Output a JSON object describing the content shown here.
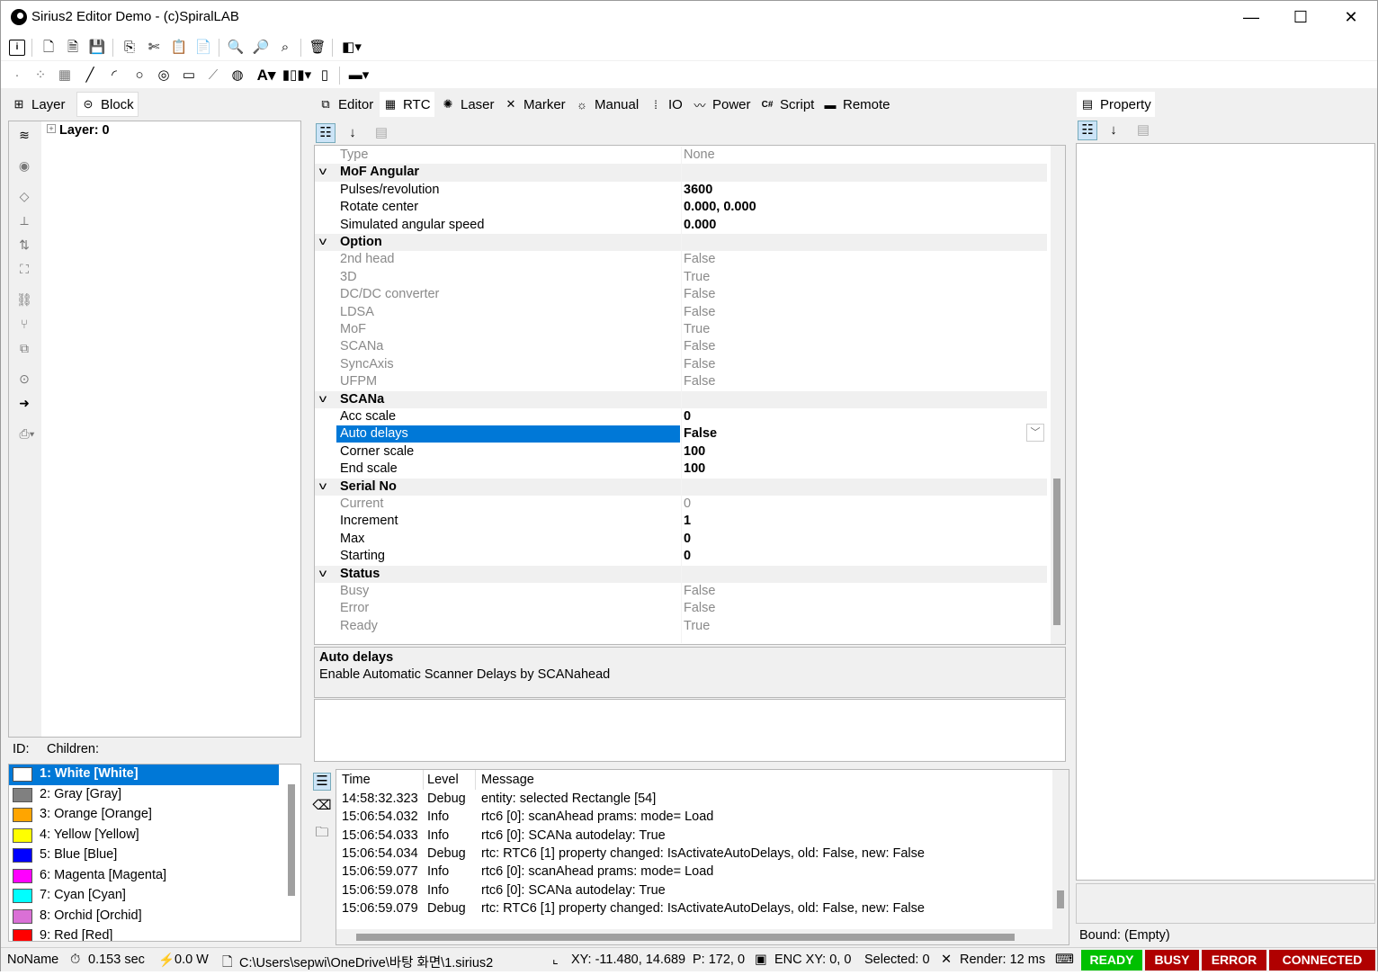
{
  "window": {
    "title": "Sirius2 Editor Demo - (c)SpiralLAB",
    "minimize": "—",
    "maximize": "☐",
    "close": "✕"
  },
  "left_tabs": {
    "layer": "Layer",
    "block": "Block"
  },
  "tree": {
    "root": "Layer: 0"
  },
  "id_bar": {
    "id": "ID:",
    "children": "Children:"
  },
  "layers": [
    {
      "label": "1: White [White]",
      "color": "#ffffff"
    },
    {
      "label": "2: Gray [Gray]",
      "color": "#808080"
    },
    {
      "label": "3: Orange [Orange]",
      "color": "#ffa500"
    },
    {
      "label": "4: Yellow [Yellow]",
      "color": "#ffff00"
    },
    {
      "label": "5: Blue [Blue]",
      "color": "#0000ff"
    },
    {
      "label": "6: Magenta [Magenta]",
      "color": "#ff00ff"
    },
    {
      "label": "7: Cyan [Cyan]",
      "color": "#00ffff"
    },
    {
      "label": "8: Orchid [Orchid]",
      "color": "#da70d6"
    },
    {
      "label": "9: Red [Red]",
      "color": "#ff0000"
    }
  ],
  "center_tabs": [
    "Editor",
    "RTC",
    "Laser",
    "Marker",
    "Manual",
    "IO",
    "Power",
    "Script",
    "Remote"
  ],
  "grid": {
    "rows": [
      {
        "n": "Type",
        "v": "None",
        "t": "dim"
      },
      {
        "n": "MoF Angular",
        "t": "cat"
      },
      {
        "n": "Pulses/revolution",
        "v": "3600",
        "t": "b"
      },
      {
        "n": "Rotate center",
        "v": "0.000, 0.000",
        "t": "b"
      },
      {
        "n": "Simulated angular speed",
        "v": "0.000",
        "t": "b"
      },
      {
        "n": "Option",
        "t": "cat"
      },
      {
        "n": "2nd head",
        "v": "False",
        "t": "dim"
      },
      {
        "n": "3D",
        "v": "True",
        "t": "dim"
      },
      {
        "n": "DC/DC converter",
        "v": "False",
        "t": "dim"
      },
      {
        "n": "LDSA",
        "v": "False",
        "t": "dim"
      },
      {
        "n": "MoF",
        "v": "True",
        "t": "dim"
      },
      {
        "n": "SCANa",
        "v": "False",
        "t": "dim"
      },
      {
        "n": "SyncAxis",
        "v": "False",
        "t": "dim"
      },
      {
        "n": "UFPM",
        "v": "False",
        "t": "dim"
      },
      {
        "n": "SCANa",
        "t": "cat"
      },
      {
        "n": "Acc scale",
        "v": "0",
        "t": "b"
      },
      {
        "n": "Auto delays",
        "v": "False",
        "t": "sel"
      },
      {
        "n": "Corner scale",
        "v": "100",
        "t": "b"
      },
      {
        "n": "End scale",
        "v": "100",
        "t": "b"
      },
      {
        "n": "Serial No",
        "t": "cat"
      },
      {
        "n": "Current",
        "v": "0",
        "t": "dim"
      },
      {
        "n": "Increment",
        "v": "1",
        "t": "b"
      },
      {
        "n": "Max",
        "v": "0",
        "t": "b"
      },
      {
        "n": "Starting",
        "v": "0",
        "t": "b"
      },
      {
        "n": "Status",
        "t": "cat"
      },
      {
        "n": "Busy",
        "v": "False",
        "t": "dim"
      },
      {
        "n": "Error",
        "v": "False",
        "t": "dim"
      },
      {
        "n": "Ready",
        "v": "True",
        "t": "dim"
      }
    ]
  },
  "description": {
    "title": "Auto delays",
    "text": "Enable Automatic Scanner Delays by SCANahead"
  },
  "log": {
    "headers": {
      "time": "Time",
      "level": "Level",
      "message": "Message"
    },
    "rows": [
      {
        "time": "14:58:32.323",
        "level": "Debug",
        "message": "entity: selected Rectangle [54]"
      },
      {
        "time": "15:06:54.032",
        "level": "Info",
        "message": "rtc6 [0]: scanAhead prams: mode= Load"
      },
      {
        "time": "15:06:54.033",
        "level": "Info",
        "message": "rtc6 [0]: SCANa autodelay: True"
      },
      {
        "time": "15:06:54.034",
        "level": "Debug",
        "message": "rtc: RTC6 [1] property changed: IsActivateAutoDelays, old: False, new: False"
      },
      {
        "time": "15:06:59.077",
        "level": "Info",
        "message": "rtc6 [0]: scanAhead prams: mode= Load"
      },
      {
        "time": "15:06:59.078",
        "level": "Info",
        "message": "rtc6 [0]: SCANa autodelay: True"
      },
      {
        "time": "15:06:59.079",
        "level": "Debug",
        "message": "rtc: RTC6 [1] property changed: IsActivateAutoDelays, old: False, new: False"
      }
    ]
  },
  "property": {
    "tab": "Property",
    "bound": "Bound: (Empty)"
  },
  "status": {
    "name": "NoName",
    "time": "0.153 sec",
    "power": "0.0 W",
    "path": "C:\\Users\\sepwi\\OneDrive\\바탕 화면\\1.sirius2",
    "xy": "XY: -11.480, 14.689",
    "p": "P: 172, 0",
    "enc": "ENC XY: 0, 0",
    "selected": "Selected: 0",
    "render": "Render: 12 ms",
    "ready": "READY",
    "busy": "BUSY",
    "error": "ERROR",
    "connected": "CONNECTED",
    "ready_color": "#00c000",
    "busy_color": "#b00000",
    "error_color": "#b00000",
    "connected_color": "#b00000"
  }
}
